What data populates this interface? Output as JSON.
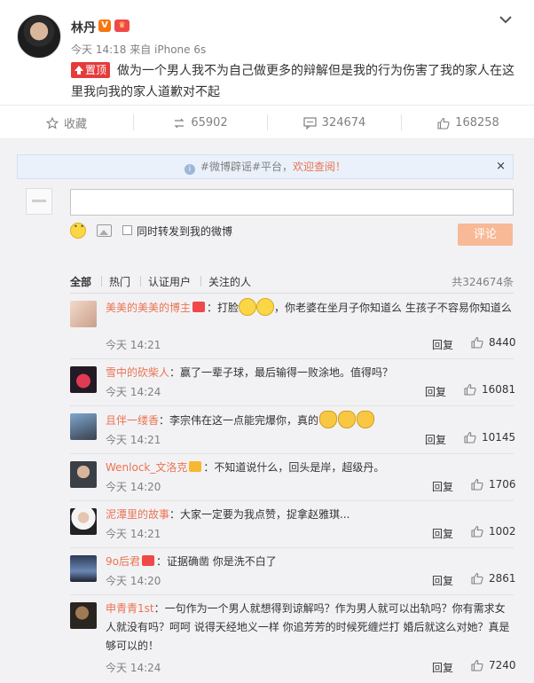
{
  "post": {
    "author": "林丹",
    "verified_badge": "V",
    "vip_badge": "♛",
    "meta": "今天 14:18 来自 iPhone 6s",
    "pin_label": "置顶",
    "text": "做为一个男人我不为自己做更多的辩解但是我的行为伤害了我的家人在这里我向我的家人道歉对不起"
  },
  "actions": {
    "favorite": "收藏",
    "repost_count": "65902",
    "comment_count": "324674",
    "like_count": "168258"
  },
  "notice": {
    "prefix": "#微博辟谣#平台，",
    "highlight": "欢迎查阅！",
    "close": "×"
  },
  "composer": {
    "placeholder": "",
    "forward_label": "同时转发到我的微博",
    "submit_label": "评论"
  },
  "tabs": {
    "items": [
      "全部",
      "热门",
      "认证用户",
      "关注的人"
    ],
    "total": "共324674条"
  },
  "comments": [
    {
      "nick": "美美的美美的博主",
      "text": "：打脸",
      "text2": "，你老婆在坐月子你知道么 生孩子不容易你知道么",
      "time": "今天 14:21",
      "likes": "8440"
    },
    {
      "nick": "雪中的砍柴人",
      "text": "：赢了一辈子球，最后输得一败涂地。值得吗？",
      "time": "今天 14:24",
      "likes": "16081"
    },
    {
      "nick": "且伴一缕香",
      "text": "：李宗伟在这一点能完爆你，真的",
      "time": "今天 14:21",
      "likes": "10145"
    },
    {
      "nick": "Wenlock_文洛克",
      "text": "：不知道说什么，回头是岸，超级丹。",
      "time": "今天 14:20",
      "likes": "1706"
    },
    {
      "nick": "泥潭里的故事",
      "text": "：大家一定要为我点赞，捉拿赵雅琪...",
      "time": "今天 14:21",
      "likes": "1002"
    },
    {
      "nick": "9o后君",
      "text": "：证据确凿 你是洗不白了",
      "time": "今天 14:20",
      "likes": "2861"
    },
    {
      "nick": "申青青1st",
      "text": "：一句作为一个男人就想得到谅解吗？作为男人就可以出轨吗？你有需求女人就没有吗？呵呵 说得天经地义一样 你追芳芳的时候死缠烂打 婚后就这么对她？真是够可以的！",
      "time": "今天 14:24",
      "likes": "7240"
    }
  ],
  "reply_label": "回复",
  "colors": {
    "accent": "#eb7350",
    "pin": "#e53b3b",
    "submit": "#f8b996"
  }
}
